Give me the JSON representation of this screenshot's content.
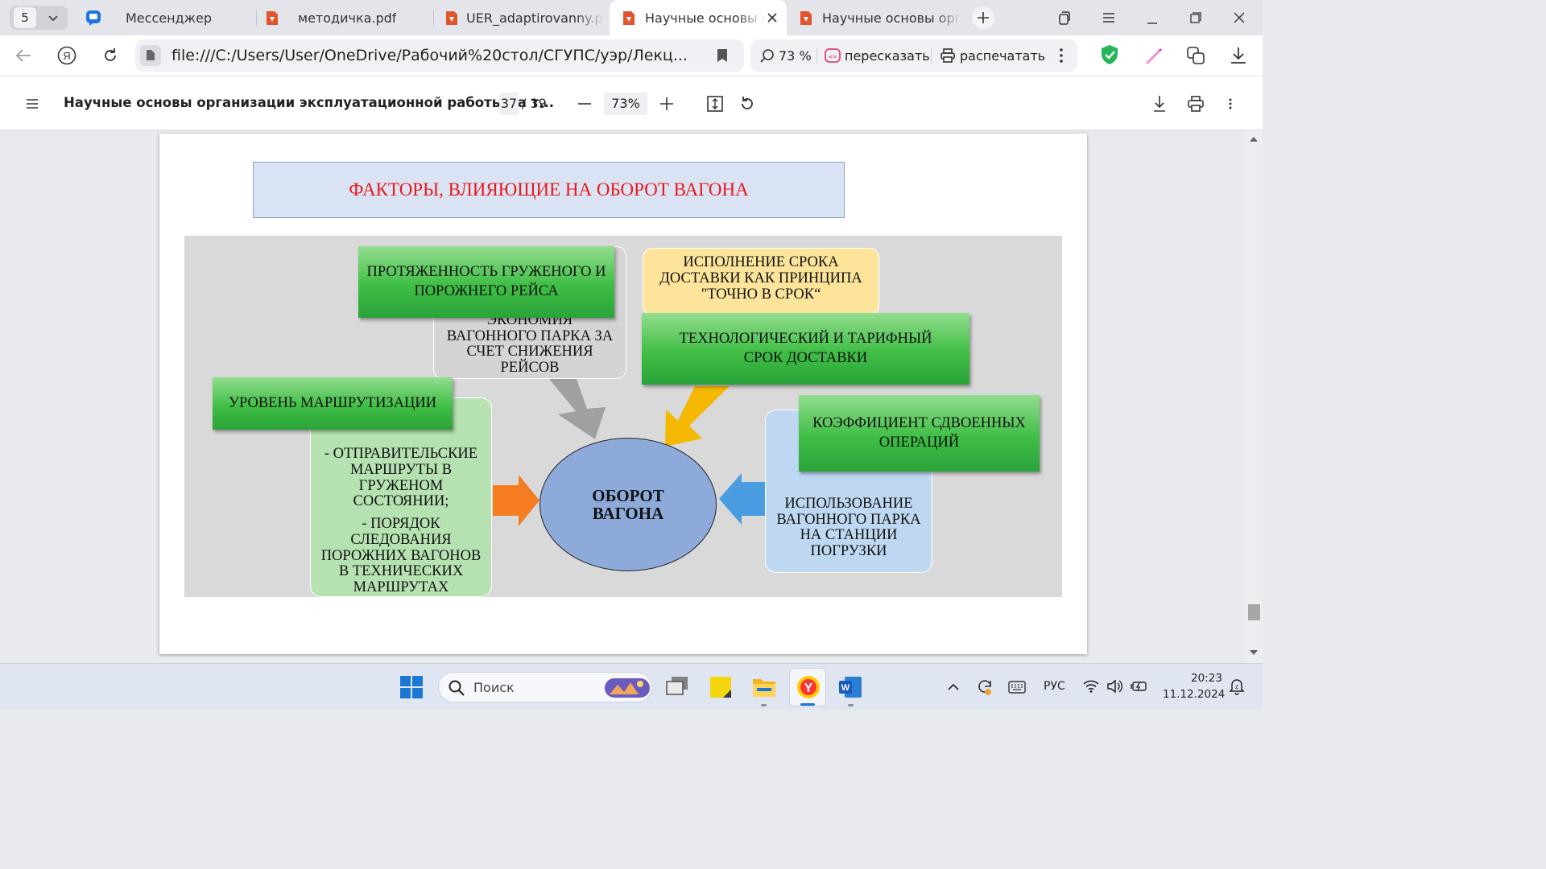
{
  "browser": {
    "tab_count": "5",
    "tabs": [
      {
        "label": "Мессенджер",
        "icon": "messenger-icon"
      },
      {
        "label": "методичка.pdf",
        "icon": "pdf-icon"
      },
      {
        "label": "UER_adaptirovanny.pdf",
        "icon": "pdf-icon"
      },
      {
        "label": "Научные основы организации",
        "icon": "pdf-icon",
        "active": true
      },
      {
        "label": "Научные основы организации",
        "icon": "pdf-icon"
      }
    ],
    "address": "file:///C:/Users/User/OneDrive/Рабочий%20стол/СГУПС/уэр/Лекц...",
    "zoom_label": "73 %",
    "retell_label": "пересказать",
    "print_label": "распечатать",
    "accent_color": "#e2542b"
  },
  "pdf_toolbar": {
    "title": "Научные основы организации эксплуатационной работы на т...",
    "current_page": "37",
    "total_pages": "/ 39",
    "zoom": "73%"
  },
  "slide": {
    "title": "ФАКТОРЫ, ВЛИЯЮЩИЕ НА ОБОРОТ ВАГОНА",
    "title_color": "#e8181b",
    "center": "ОБОРОТ ВАГОНА",
    "trip_length": "ПРОТЯЖЕННОСТЬ ГРУЖЕНОГО И ПОРОЖНЕГО РЕЙСА",
    "economy": "ЭКОНОМИЯ ВАГОННОГО ПАРКА ЗА СЧЕТ СНИЖЕНИЯ РЕЙСОВ",
    "on_time": "ИСПОЛНЕНИЕ СРОКА ДОСТАВКИ КАК ПРИНЦИПА \"ТОЧНО В СРОК“",
    "delivery_term": "ТЕХНОЛОГИЧЕСКИЙ И ТАРИФНЫЙ СРОК ДОСТАВКИ",
    "routing_level": "УРОВЕНЬ МАРШРУТИЗАЦИИ",
    "routing_detail_1": "- ОТПРАВИТЕЛЬСКИЕ МАРШРУТЫ В ГРУЖЕНОМ СОСТОЯНИИ;",
    "routing_detail_2": "- ПОРЯДОК СЛЕДОВАНИЯ ПОРОЖНИХ ВАГОНОВ В ТЕХНИЧЕСКИХ МАРШРУТАХ",
    "dual_ops": "КОЭФФИЦИЕНТ СДВОЕННЫХ ОПЕРАЦИЙ",
    "loading_station": "ИСПОЛЬЗОВАНИЕ ВАГОННОГО ПАРКА НА СТАНЦИИ ПОГРУЗКИ"
  },
  "taskbar": {
    "search_placeholder": "Поиск",
    "language": "РУС",
    "time": "20:23",
    "date": "11.12.2024"
  }
}
